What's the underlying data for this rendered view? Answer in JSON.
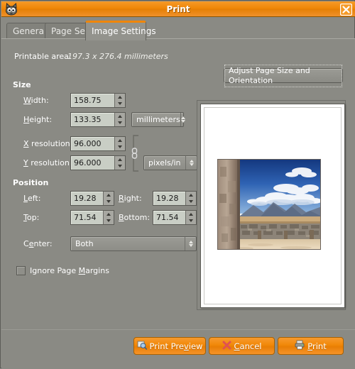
{
  "window": {
    "title": "Print",
    "app_icon": "gimp-wilber-icon",
    "close_icon": "close-icon"
  },
  "tabs": [
    {
      "label": "General",
      "active": false
    },
    {
      "label": "Page Setup",
      "active": false
    },
    {
      "label": "Image Settings",
      "active": true
    }
  ],
  "info": {
    "printable_area_label": "Printable area:",
    "printable_area_value": "197.3 x 276.4 millimeters",
    "adjust_button": "Adjust Page Size and Orientation"
  },
  "size": {
    "heading": "Size",
    "fields": [
      {
        "label": "Width:",
        "value": "158.75"
      },
      {
        "label": "Height:",
        "value": "133.35"
      },
      {
        "label": "X resolution:",
        "value": "96.000"
      },
      {
        "label": "Y resolution:",
        "value": "96.000"
      }
    ],
    "size_unit": "millimeters",
    "resolution_unit": "pixels/in",
    "chain_icon": "chain-link-icon"
  },
  "position": {
    "heading": "Position",
    "left_label": "Left:",
    "left_value": "19.28",
    "right_label": "Right:",
    "right_value": "19.28",
    "top_label": "Top:",
    "top_value": "71.54",
    "bottom_label": "Bottom:",
    "bottom_value": "71.54",
    "center_label": "Center:",
    "center_value": "Both",
    "ignore_margins_label": "Ignore Page Margins",
    "ignore_margins_checked": false
  },
  "preview": {
    "name": "page-preview",
    "photo_description": "desert courtyard with stone wall, blue sky and mountains"
  },
  "actions": [
    {
      "label": "Print Preview",
      "icon": "print-preview-icon"
    },
    {
      "label": "Cancel",
      "icon": "cancel-x-icon"
    },
    {
      "label": "Print",
      "icon": "printer-icon"
    }
  ],
  "colors": {
    "accent": "#f08606",
    "window_bg": "#8a8a84",
    "entry_bg": "#c9cec5",
    "title_text": "#ffffff"
  }
}
